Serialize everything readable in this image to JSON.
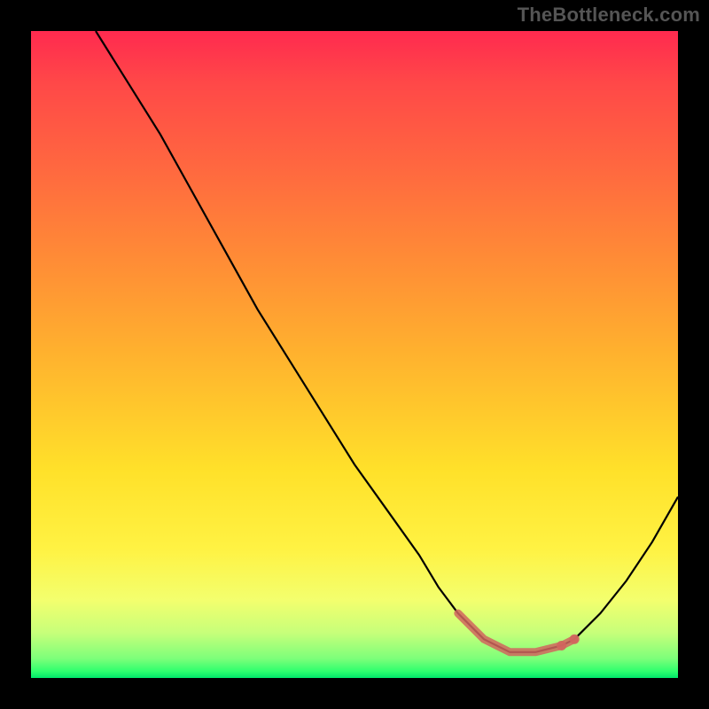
{
  "watermark": "TheBottleneck.com",
  "chart_data": {
    "type": "line",
    "title": "",
    "xlabel": "",
    "ylabel": "",
    "xlim": [
      0,
      100
    ],
    "ylim": [
      0,
      100
    ],
    "grid": false,
    "legend": false,
    "series": [
      {
        "name": "curve",
        "x": [
          10,
          15,
          20,
          25,
          30,
          35,
          40,
          45,
          50,
          55,
          60,
          63,
          66,
          70,
          74,
          78,
          82,
          84,
          88,
          92,
          96,
          100
        ],
        "values": [
          100,
          92,
          84,
          75,
          66,
          57,
          49,
          41,
          33,
          26,
          19,
          14,
          10,
          6,
          4,
          4,
          5,
          6,
          10,
          15,
          21,
          28
        ]
      }
    ],
    "highlight": {
      "name": "optimal-range",
      "x_start": 64,
      "x_end": 84,
      "y": 4
    }
  }
}
